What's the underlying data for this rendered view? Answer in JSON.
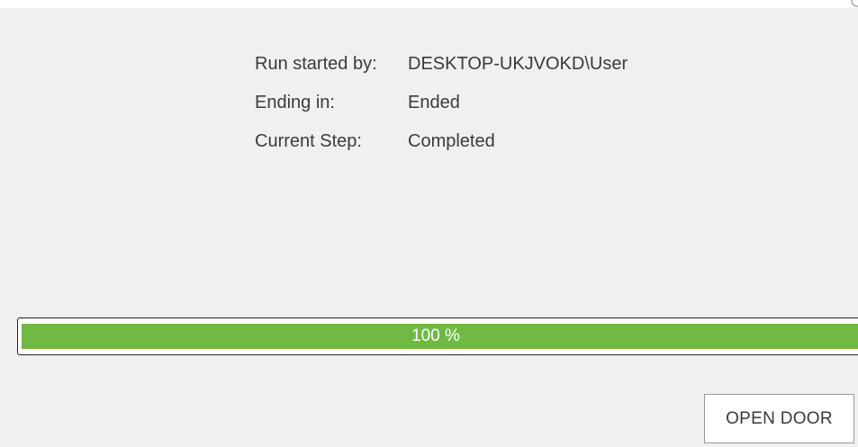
{
  "run_info": {
    "rows": [
      {
        "label": "Run started by:",
        "value": "DESKTOP-UKJVOKD\\User"
      },
      {
        "label": "Ending in:",
        "value": "Ended"
      },
      {
        "label": "Current Step:",
        "value": "Completed"
      }
    ]
  },
  "progress": {
    "percent": 100,
    "label": "100 %",
    "fill_color": "#70b944"
  },
  "actions": {
    "open_door_label": "OPEN DOOR"
  }
}
